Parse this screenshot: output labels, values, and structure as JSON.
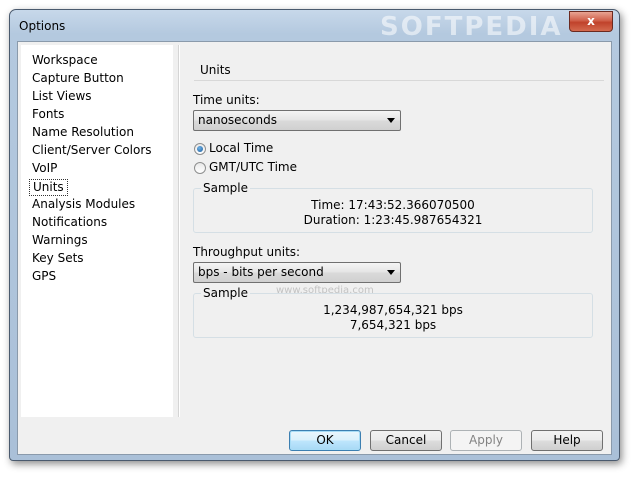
{
  "window": {
    "title": "Options",
    "close_label": "x",
    "watermark": "SOFTPEDIA",
    "watermark_small": "www.softpedia.com"
  },
  "nav": {
    "items": [
      {
        "label": "Workspace"
      },
      {
        "label": "Capture Button"
      },
      {
        "label": "List Views"
      },
      {
        "label": "Fonts"
      },
      {
        "label": "Name Resolution"
      },
      {
        "label": "Client/Server Colors"
      },
      {
        "label": "VoIP"
      },
      {
        "label": "Units",
        "selected": true
      },
      {
        "label": "Analysis Modules"
      },
      {
        "label": "Notifications"
      },
      {
        "label": "Warnings"
      },
      {
        "label": "Key Sets"
      },
      {
        "label": "GPS"
      }
    ]
  },
  "units": {
    "section_title": "Units",
    "time_units_label": "Time units:",
    "time_units_value": "nanoseconds",
    "radio_local": "Local Time",
    "radio_gmt": "GMT/UTC Time",
    "selected_radio": "local",
    "time_sample": {
      "title": "Sample",
      "line1": "Time: 17:43:52.366070500",
      "line2": "Duration: 1:23:45.987654321"
    },
    "throughput_label": "Throughput units:",
    "throughput_value": "bps - bits per second",
    "throughput_sample": {
      "title": "Sample",
      "line1": "1,234,987,654,321 bps",
      "line2": "7,654,321 bps"
    }
  },
  "buttons": {
    "ok": "OK",
    "cancel": "Cancel",
    "apply": "Apply",
    "help": "Help"
  },
  "colors": {
    "frame": "#b4c9df",
    "close": "#c7432c",
    "default_button": "#3c7fb1"
  }
}
